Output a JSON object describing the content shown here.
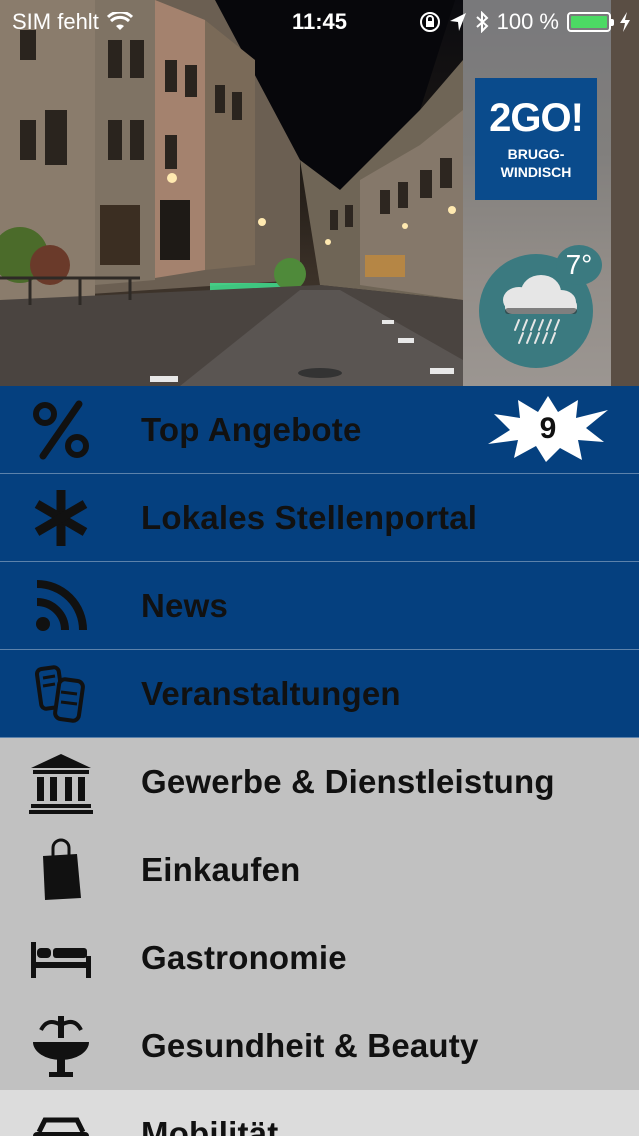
{
  "status_bar": {
    "carrier": "SIM fehlt",
    "time": "11:45",
    "battery_percent": "100 %",
    "battery_level": 1.0
  },
  "header": {
    "logo_main": "2GO!",
    "logo_sub_line1": "BRUGG-",
    "logo_sub_line2": "WINDISCH",
    "temperature": "7°"
  },
  "menu": {
    "items": [
      {
        "label": "Top Angebote",
        "icon": "percent-icon",
        "badge": "9"
      },
      {
        "label": "Lokales Stellenportal",
        "icon": "asterisk-icon"
      },
      {
        "label": "News",
        "icon": "rss-icon"
      },
      {
        "label": "Veranstaltungen",
        "icon": "tickets-icon"
      },
      {
        "label": "Gewerbe & Dienstleistung",
        "icon": "bank-icon"
      },
      {
        "label": "Einkaufen",
        "icon": "shopping-bag-icon"
      },
      {
        "label": "Gastronomie",
        "icon": "bed-icon"
      },
      {
        "label": "Gesundheit & Beauty",
        "icon": "fountain-icon"
      },
      {
        "label": "Mobilität",
        "icon": "car-icon"
      }
    ]
  },
  "colors": {
    "menu_blue": "#05407f",
    "menu_gray": "#c1c1c1",
    "logo_blue": "#0a4b8c",
    "weather_teal": "#3b7a80",
    "battery_green": "#4cd964"
  }
}
